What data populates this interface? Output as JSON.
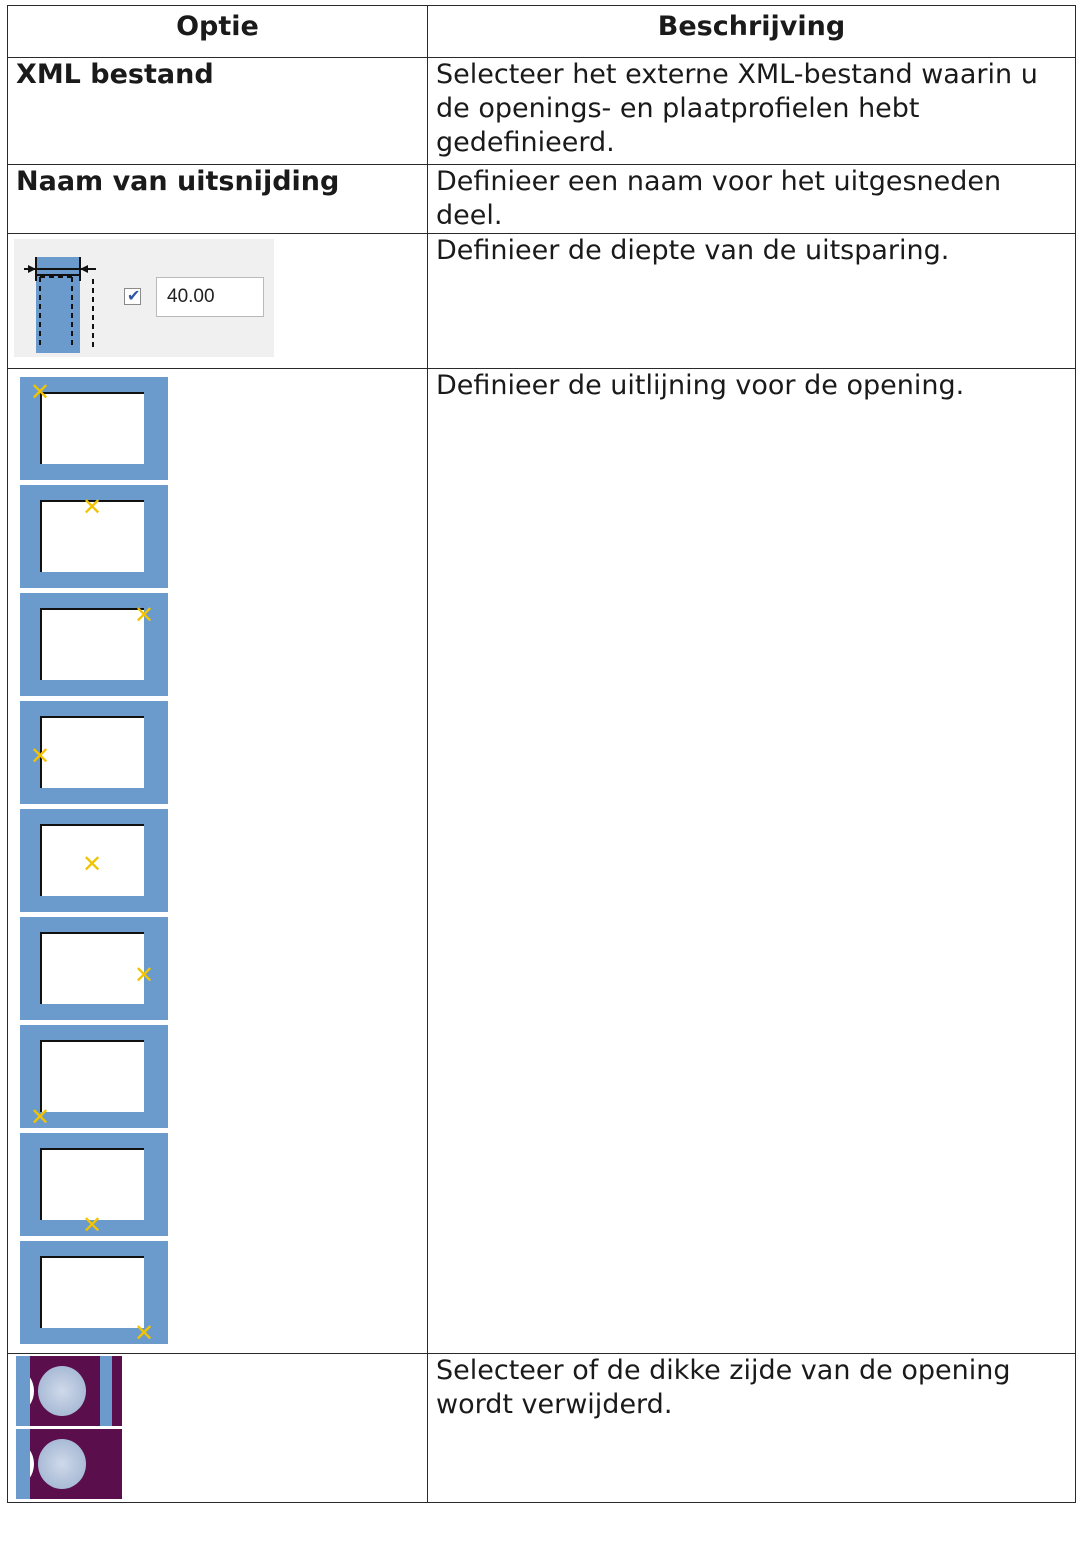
{
  "table": {
    "header": {
      "option": "Optie",
      "description": "Beschrijving"
    },
    "rows": [
      {
        "option": "XML bestand",
        "description": "Selecteer het externe XML-bestand waarin u de openings- en plaatprofielen hebt gedefinieerd."
      },
      {
        "option": "Naam van uitsnijding",
        "description": "Definieer een naam voor het uitgesneden deel."
      },
      {
        "option": "",
        "description": "Definieer de diepte van de uitsparing.",
        "depth_checked": true,
        "depth_value": "40.00"
      },
      {
        "option": "",
        "description": "Definieer de uitlijning voor de opening."
      },
      {
        "option": "",
        "description": "Selecteer of de dikke zijde van de opening wordt verwijderd."
      }
    ]
  },
  "alignment_options": [
    {
      "name": "top-left",
      "icon": "alignment-top-left-icon"
    },
    {
      "name": "top-center",
      "icon": "alignment-top-center-icon"
    },
    {
      "name": "top-right",
      "icon": "alignment-top-right-icon"
    },
    {
      "name": "middle-left",
      "icon": "alignment-middle-left-icon"
    },
    {
      "name": "middle-center",
      "icon": "alignment-middle-center-icon"
    },
    {
      "name": "middle-right",
      "icon": "alignment-middle-right-icon"
    },
    {
      "name": "bottom-left",
      "icon": "alignment-bottom-left-icon"
    },
    {
      "name": "bottom-center",
      "icon": "alignment-bottom-center-icon"
    },
    {
      "name": "bottom-right",
      "icon": "alignment-bottom-right-icon"
    }
  ],
  "colors": {
    "tile_blue": "#6b9bcc",
    "marker_yellow": "#f2c300",
    "plate_purple": "#5a0f4c"
  }
}
